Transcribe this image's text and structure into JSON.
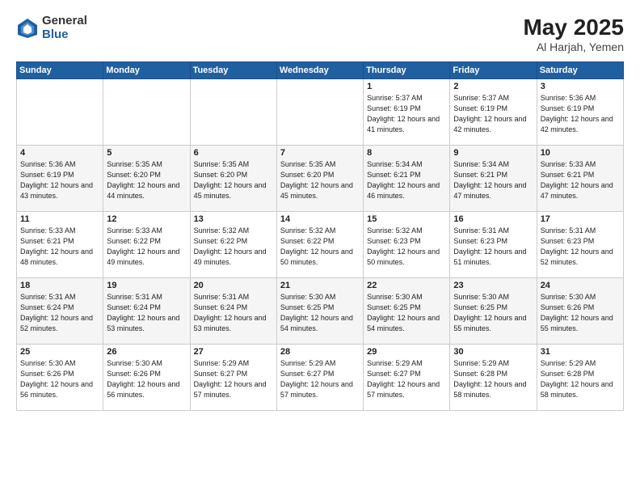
{
  "header": {
    "logo_general": "General",
    "logo_blue": "Blue",
    "month_year": "May 2025",
    "location": "Al Harjah, Yemen"
  },
  "days_of_week": [
    "Sunday",
    "Monday",
    "Tuesday",
    "Wednesday",
    "Thursday",
    "Friday",
    "Saturday"
  ],
  "weeks": [
    [
      {
        "day": "",
        "sunrise": "",
        "sunset": "",
        "daylight": ""
      },
      {
        "day": "",
        "sunrise": "",
        "sunset": "",
        "daylight": ""
      },
      {
        "day": "",
        "sunrise": "",
        "sunset": "",
        "daylight": ""
      },
      {
        "day": "",
        "sunrise": "",
        "sunset": "",
        "daylight": ""
      },
      {
        "day": "1",
        "sunrise": "Sunrise: 5:37 AM",
        "sunset": "Sunset: 6:19 PM",
        "daylight": "Daylight: 12 hours and 41 minutes."
      },
      {
        "day": "2",
        "sunrise": "Sunrise: 5:37 AM",
        "sunset": "Sunset: 6:19 PM",
        "daylight": "Daylight: 12 hours and 42 minutes."
      },
      {
        "day": "3",
        "sunrise": "Sunrise: 5:36 AM",
        "sunset": "Sunset: 6:19 PM",
        "daylight": "Daylight: 12 hours and 42 minutes."
      }
    ],
    [
      {
        "day": "4",
        "sunrise": "Sunrise: 5:36 AM",
        "sunset": "Sunset: 6:19 PM",
        "daylight": "Daylight: 12 hours and 43 minutes."
      },
      {
        "day": "5",
        "sunrise": "Sunrise: 5:35 AM",
        "sunset": "Sunset: 6:20 PM",
        "daylight": "Daylight: 12 hours and 44 minutes."
      },
      {
        "day": "6",
        "sunrise": "Sunrise: 5:35 AM",
        "sunset": "Sunset: 6:20 PM",
        "daylight": "Daylight: 12 hours and 45 minutes."
      },
      {
        "day": "7",
        "sunrise": "Sunrise: 5:35 AM",
        "sunset": "Sunset: 6:20 PM",
        "daylight": "Daylight: 12 hours and 45 minutes."
      },
      {
        "day": "8",
        "sunrise": "Sunrise: 5:34 AM",
        "sunset": "Sunset: 6:21 PM",
        "daylight": "Daylight: 12 hours and 46 minutes."
      },
      {
        "day": "9",
        "sunrise": "Sunrise: 5:34 AM",
        "sunset": "Sunset: 6:21 PM",
        "daylight": "Daylight: 12 hours and 47 minutes."
      },
      {
        "day": "10",
        "sunrise": "Sunrise: 5:33 AM",
        "sunset": "Sunset: 6:21 PM",
        "daylight": "Daylight: 12 hours and 47 minutes."
      }
    ],
    [
      {
        "day": "11",
        "sunrise": "Sunrise: 5:33 AM",
        "sunset": "Sunset: 6:21 PM",
        "daylight": "Daylight: 12 hours and 48 minutes."
      },
      {
        "day": "12",
        "sunrise": "Sunrise: 5:33 AM",
        "sunset": "Sunset: 6:22 PM",
        "daylight": "Daylight: 12 hours and 49 minutes."
      },
      {
        "day": "13",
        "sunrise": "Sunrise: 5:32 AM",
        "sunset": "Sunset: 6:22 PM",
        "daylight": "Daylight: 12 hours and 49 minutes."
      },
      {
        "day": "14",
        "sunrise": "Sunrise: 5:32 AM",
        "sunset": "Sunset: 6:22 PM",
        "daylight": "Daylight: 12 hours and 50 minutes."
      },
      {
        "day": "15",
        "sunrise": "Sunrise: 5:32 AM",
        "sunset": "Sunset: 6:23 PM",
        "daylight": "Daylight: 12 hours and 50 minutes."
      },
      {
        "day": "16",
        "sunrise": "Sunrise: 5:31 AM",
        "sunset": "Sunset: 6:23 PM",
        "daylight": "Daylight: 12 hours and 51 minutes."
      },
      {
        "day": "17",
        "sunrise": "Sunrise: 5:31 AM",
        "sunset": "Sunset: 6:23 PM",
        "daylight": "Daylight: 12 hours and 52 minutes."
      }
    ],
    [
      {
        "day": "18",
        "sunrise": "Sunrise: 5:31 AM",
        "sunset": "Sunset: 6:24 PM",
        "daylight": "Daylight: 12 hours and 52 minutes."
      },
      {
        "day": "19",
        "sunrise": "Sunrise: 5:31 AM",
        "sunset": "Sunset: 6:24 PM",
        "daylight": "Daylight: 12 hours and 53 minutes."
      },
      {
        "day": "20",
        "sunrise": "Sunrise: 5:31 AM",
        "sunset": "Sunset: 6:24 PM",
        "daylight": "Daylight: 12 hours and 53 minutes."
      },
      {
        "day": "21",
        "sunrise": "Sunrise: 5:30 AM",
        "sunset": "Sunset: 6:25 PM",
        "daylight": "Daylight: 12 hours and 54 minutes."
      },
      {
        "day": "22",
        "sunrise": "Sunrise: 5:30 AM",
        "sunset": "Sunset: 6:25 PM",
        "daylight": "Daylight: 12 hours and 54 minutes."
      },
      {
        "day": "23",
        "sunrise": "Sunrise: 5:30 AM",
        "sunset": "Sunset: 6:25 PM",
        "daylight": "Daylight: 12 hours and 55 minutes."
      },
      {
        "day": "24",
        "sunrise": "Sunrise: 5:30 AM",
        "sunset": "Sunset: 6:26 PM",
        "daylight": "Daylight: 12 hours and 55 minutes."
      }
    ],
    [
      {
        "day": "25",
        "sunrise": "Sunrise: 5:30 AM",
        "sunset": "Sunset: 6:26 PM",
        "daylight": "Daylight: 12 hours and 56 minutes."
      },
      {
        "day": "26",
        "sunrise": "Sunrise: 5:30 AM",
        "sunset": "Sunset: 6:26 PM",
        "daylight": "Daylight: 12 hours and 56 minutes."
      },
      {
        "day": "27",
        "sunrise": "Sunrise: 5:29 AM",
        "sunset": "Sunset: 6:27 PM",
        "daylight": "Daylight: 12 hours and 57 minutes."
      },
      {
        "day": "28",
        "sunrise": "Sunrise: 5:29 AM",
        "sunset": "Sunset: 6:27 PM",
        "daylight": "Daylight: 12 hours and 57 minutes."
      },
      {
        "day": "29",
        "sunrise": "Sunrise: 5:29 AM",
        "sunset": "Sunset: 6:27 PM",
        "daylight": "Daylight: 12 hours and 57 minutes."
      },
      {
        "day": "30",
        "sunrise": "Sunrise: 5:29 AM",
        "sunset": "Sunset: 6:28 PM",
        "daylight": "Daylight: 12 hours and 58 minutes."
      },
      {
        "day": "31",
        "sunrise": "Sunrise: 5:29 AM",
        "sunset": "Sunset: 6:28 PM",
        "daylight": "Daylight: 12 hours and 58 minutes."
      }
    ]
  ]
}
